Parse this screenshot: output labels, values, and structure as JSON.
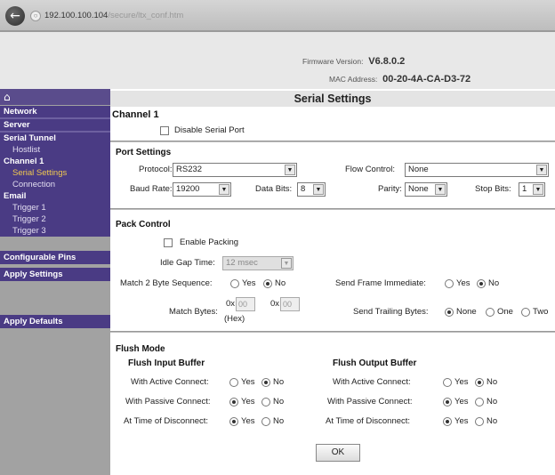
{
  "browser": {
    "nav_back_icon": "back-arrow-icon",
    "address_host": "192.100.100.104",
    "address_path": "/secure/ltx_conf.htm"
  },
  "header": {
    "firmware_label": "Firmware Version:",
    "firmware_value": "V6.8.0.2",
    "mac_label": "MAC Address:",
    "mac_value": "00-20-4A-CA-D3-72"
  },
  "sidebar": {
    "home_icon": "home-icon",
    "network": "Network",
    "server": "Server",
    "serial_tunnel": "Serial Tunnel",
    "hostlist": "Hostlist",
    "channel1": "Channel 1",
    "serial_settings": "Serial Settings",
    "connection": "Connection",
    "email": "Email",
    "trigger1": "Trigger 1",
    "trigger2": "Trigger 2",
    "trigger3": "Trigger 3",
    "configurable_pins": "Configurable Pins",
    "apply_settings": "Apply Settings",
    "apply_defaults": "Apply Defaults",
    "active_color": "#f0c850"
  },
  "main": {
    "title": "Serial Settings",
    "channel_heading": "Channel 1",
    "disable_serial_port": "Disable Serial Port",
    "port_settings": {
      "heading": "Port Settings",
      "protocol_label": "Protocol:",
      "protocol_value": "RS232",
      "flow_control_label": "Flow Control:",
      "flow_control_value": "None",
      "baud_rate_label": "Baud Rate:",
      "baud_rate_value": "19200",
      "data_bits_label": "Data Bits:",
      "data_bits_value": "8",
      "parity_label": "Parity:",
      "parity_value": "None",
      "stop_bits_label": "Stop Bits:",
      "stop_bits_value": "1"
    },
    "pack_control": {
      "heading": "Pack Control",
      "enable_packing": "Enable Packing",
      "idle_gap_label": "Idle Gap Time:",
      "idle_gap_value": "12 msec",
      "match2_label": "Match 2 Byte Sequence:",
      "yes": "Yes",
      "no": "No",
      "send_frame_label": "Send Frame Immediate:",
      "match_bytes_label": "Match Bytes:",
      "hex_prefix": "0x",
      "hex_value": "00",
      "hex_note": "(Hex)",
      "send_trailing_label": "Send Trailing Bytes:",
      "opt_none": "None",
      "opt_one": "One",
      "opt_two": "Two"
    },
    "flush_mode": {
      "heading": "Flush Mode",
      "input_buffer": "Flush Input Buffer",
      "output_buffer": "Flush Output Buffer",
      "active_connect": "With Active Connect:",
      "passive_connect": "With Passive Connect:",
      "time_disconnect": "At Time of Disconnect:",
      "yes": "Yes",
      "no": "No"
    },
    "ok_label": "OK"
  }
}
